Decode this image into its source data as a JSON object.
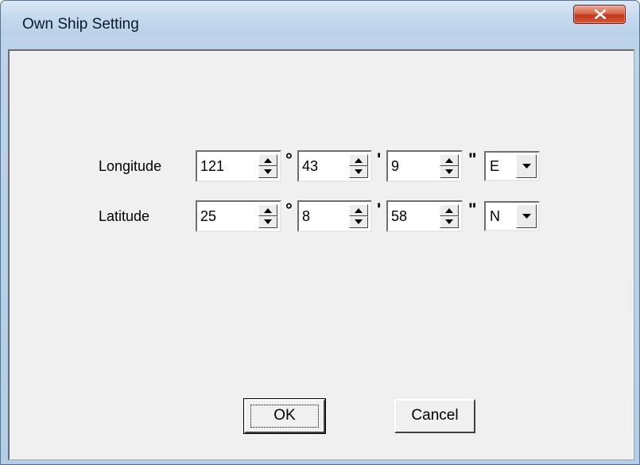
{
  "window": {
    "title": "Own Ship Setting",
    "close_icon": "close-x-icon"
  },
  "longitude": {
    "label": "Longitude",
    "degrees": "121",
    "minutes": "43",
    "seconds": "9",
    "hemisphere": "E"
  },
  "latitude": {
    "label": "Latitude",
    "degrees": "25",
    "minutes": "8",
    "seconds": "58",
    "hemisphere": "N"
  },
  "units": {
    "degree": "°",
    "minute": "'",
    "second": "\""
  },
  "buttons": {
    "ok": "OK",
    "cancel": "Cancel"
  },
  "colors": {
    "title_bar": "#c6daee",
    "close_button": "#c2391b",
    "client_background": "#f0f0f0"
  }
}
